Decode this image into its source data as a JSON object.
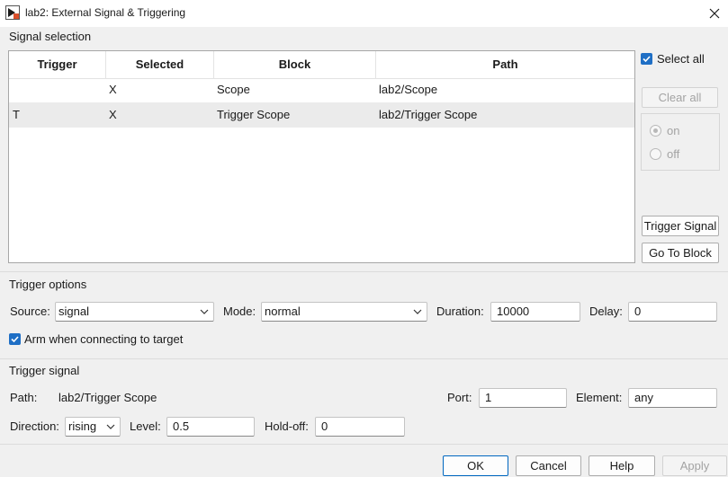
{
  "window": {
    "title": "lab2: External Signal & Triggering"
  },
  "signal_selection": {
    "section_label": "Signal selection",
    "columns": [
      "Trigger",
      "Selected",
      "Block",
      "Path"
    ],
    "rows": [
      {
        "trigger": "",
        "selected": "X",
        "block": "Scope",
        "path": "lab2/Scope"
      },
      {
        "trigger": "T",
        "selected": "X",
        "block": "Trigger Scope",
        "path": "lab2/Trigger Scope"
      }
    ],
    "select_all_label": "Select all",
    "select_all_checked": true,
    "clear_all_label": "Clear all",
    "radio_on_label": "on",
    "radio_off_label": "off",
    "trigger_signal_button": "Trigger Signal",
    "go_to_block_button": "Go To Block"
  },
  "trigger_options": {
    "section_label": "Trigger options",
    "source_label": "Source:",
    "source_value": "signal",
    "mode_label": "Mode:",
    "mode_value": "normal",
    "duration_label": "Duration:",
    "duration_value": "10000",
    "delay_label": "Delay:",
    "delay_value": "0",
    "arm_label": "Arm when connecting to target",
    "arm_checked": true
  },
  "trigger_signal": {
    "section_label": "Trigger signal",
    "path_label": "Path:",
    "path_value": "lab2/Trigger Scope",
    "port_label": "Port:",
    "port_value": "1",
    "element_label": "Element:",
    "element_value": "any",
    "direction_label": "Direction:",
    "direction_value": "rising",
    "level_label": "Level:",
    "level_value": "0.5",
    "holdoff_label": "Hold-off:",
    "holdoff_value": "0"
  },
  "footer": {
    "ok": "OK",
    "cancel": "Cancel",
    "help": "Help",
    "apply": "Apply"
  },
  "colors": {
    "accent": "#1f6fc5",
    "selected_row": "#ebebeb",
    "background": "#f0f0f0"
  }
}
